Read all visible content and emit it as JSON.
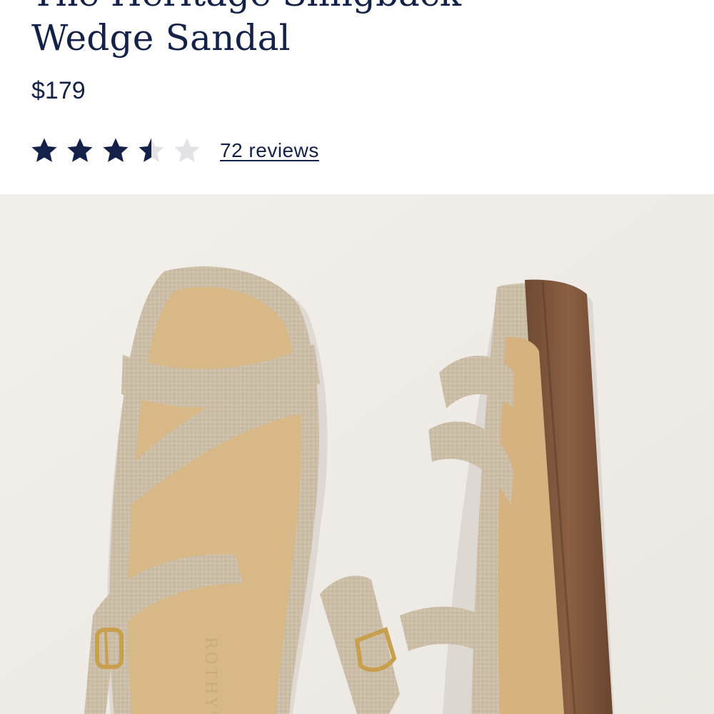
{
  "product": {
    "title_prev_line": "The Heritage Slingback",
    "title": "Wedge Sandal",
    "price": "$179",
    "rating_value": 3.5,
    "rating_max": 5,
    "reviews_label": "72 reviews",
    "image_brand_mark": "ROTHY'S"
  },
  "colors": {
    "navy": "#14224a",
    "star_empty": "#e3e3e6",
    "image_background": "#f1eeeb"
  }
}
